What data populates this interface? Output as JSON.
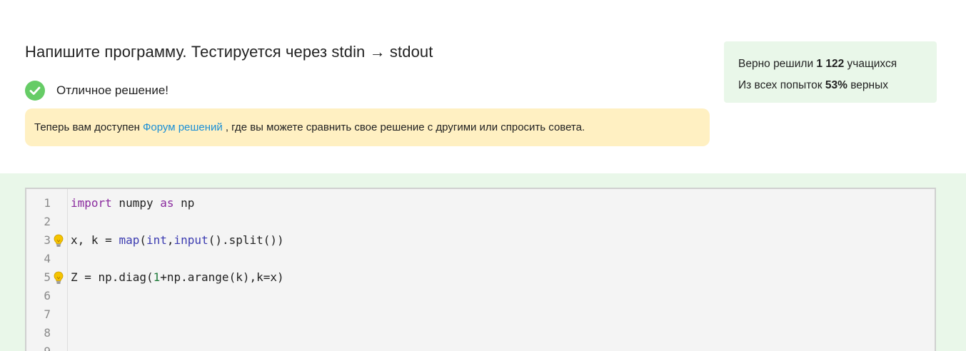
{
  "task": {
    "title": "Напишите программу. Тестируется через stdin → stdout"
  },
  "status": {
    "icon": "check-circle-icon",
    "text": "Отличное решение!"
  },
  "notice": {
    "prefix": "Теперь вам доступен",
    "link": "Форум решений",
    "suffix": ", где вы можете сравнить свое решение с другими или спросить совета."
  },
  "stats": {
    "solved_prefix": "Верно решили",
    "solved_count": "1 122",
    "solved_suffix": "учащихся",
    "attempts_prefix": "Из всех попыток",
    "attempts_percent": "53%",
    "attempts_suffix": "верных"
  },
  "editor": {
    "lines": [
      {
        "num": "1",
        "tokens": [
          {
            "t": "import",
            "c": "kw"
          },
          {
            "t": " numpy ",
            "c": ""
          },
          {
            "t": "as",
            "c": "kw"
          },
          {
            "t": " np",
            "c": ""
          }
        ],
        "hint": false
      },
      {
        "num": "2",
        "tokens": [],
        "hint": false
      },
      {
        "num": "3",
        "tokens": [
          {
            "t": "x, k = ",
            "c": ""
          },
          {
            "t": "map",
            "c": "bi"
          },
          {
            "t": "(",
            "c": ""
          },
          {
            "t": "int",
            "c": "bi"
          },
          {
            "t": ",",
            "c": ""
          },
          {
            "t": "input",
            "c": "bi"
          },
          {
            "t": "().split())",
            "c": ""
          }
        ],
        "hint": true
      },
      {
        "num": "4",
        "tokens": [],
        "hint": false
      },
      {
        "num": "5",
        "tokens": [
          {
            "t": "Z = np.diag(",
            "c": ""
          },
          {
            "t": "1",
            "c": "num"
          },
          {
            "t": "+np.arange(k),k=x)",
            "c": ""
          }
        ],
        "hint": true
      },
      {
        "num": "6",
        "tokens": [],
        "hint": false
      },
      {
        "num": "7",
        "tokens": [],
        "hint": false
      },
      {
        "num": "8",
        "tokens": [],
        "hint": false
      },
      {
        "num": "9",
        "tokens": [],
        "hint": false
      }
    ],
    "colors": {
      "keyword": "#8a2a9e",
      "builtin": "#3a3ab0",
      "number": "#1f7a3a"
    }
  }
}
